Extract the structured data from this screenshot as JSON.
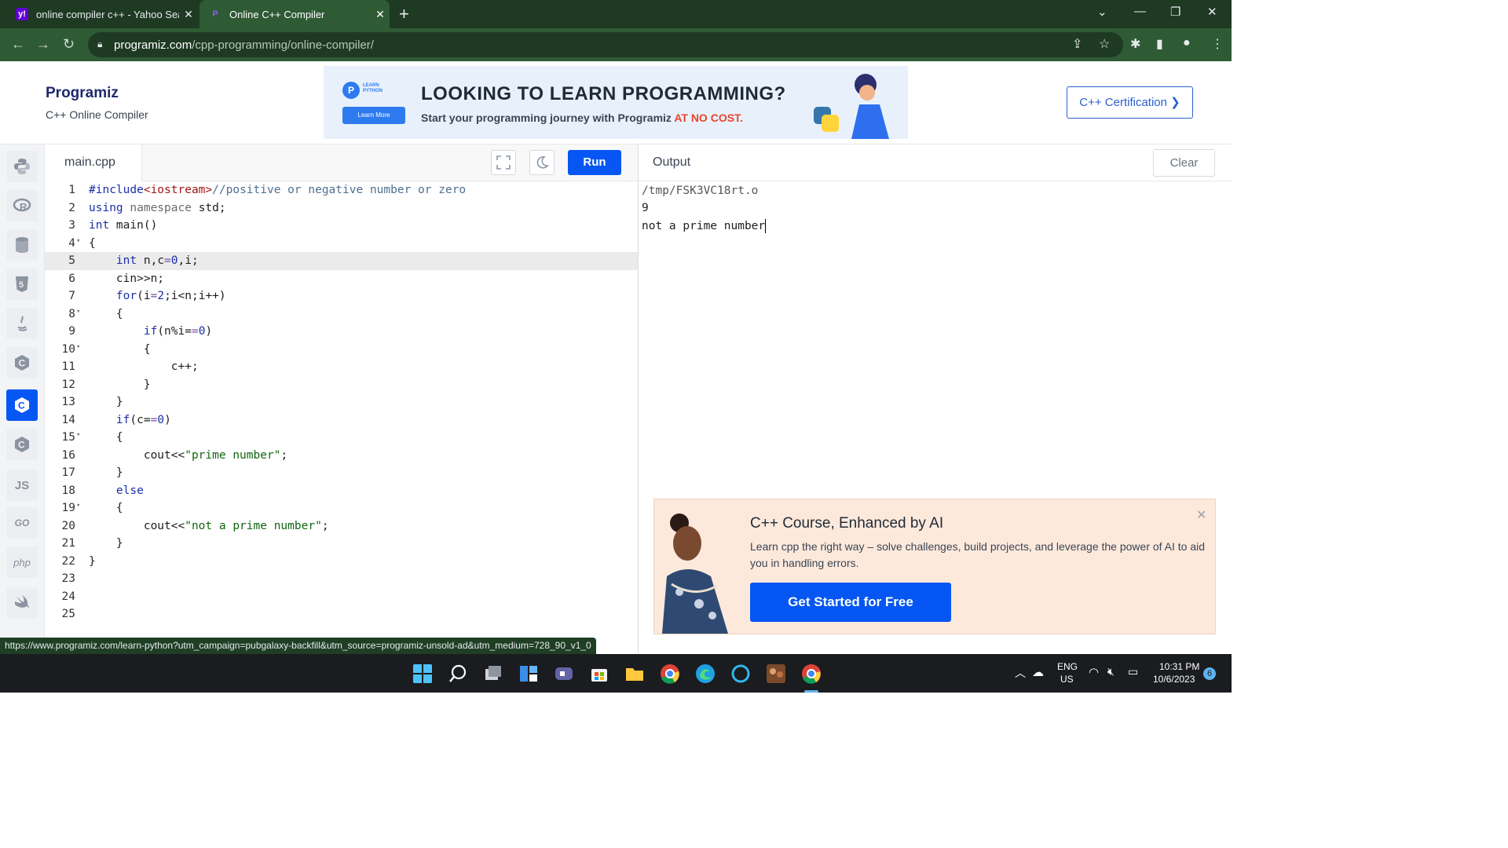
{
  "browser": {
    "tabs": [
      {
        "favicon": "y!",
        "title": "online compiler c++ - Yahoo Sea",
        "close": "✕"
      },
      {
        "favicon": "P",
        "title": "Online C++ Compiler",
        "close": "✕"
      }
    ],
    "new_tab": "+",
    "address": {
      "host": "programiz.com",
      "path": "/cpp-programming/online-compiler/"
    }
  },
  "header": {
    "logo": "Programiz",
    "subtitle": "C++ Online Compiler",
    "banner": {
      "badge": "LEARN PYTHON",
      "badge_button": "Learn More",
      "headline": "LOOKING TO LEARN PROGRAMMING?",
      "subline": "Start your programming journey with Programiz",
      "subline_highlight": "AT NO COST."
    },
    "certification_button": "C++ Certification ❯"
  },
  "sidebar": {
    "languages": [
      {
        "name": "python",
        "label": ""
      },
      {
        "name": "r",
        "label": ""
      },
      {
        "name": "sql",
        "label": ""
      },
      {
        "name": "html",
        "label": ""
      },
      {
        "name": "java",
        "label": ""
      },
      {
        "name": "c",
        "label": ""
      },
      {
        "name": "cpp",
        "label": "",
        "active": true
      },
      {
        "name": "csharp",
        "label": ""
      },
      {
        "name": "js",
        "label": "JS"
      },
      {
        "name": "go",
        "label": "GO"
      },
      {
        "name": "php",
        "label": "php"
      },
      {
        "name": "swift",
        "label": ""
      }
    ]
  },
  "editor": {
    "file_tab": "main.cpp",
    "run_label": "Run",
    "lines": [
      {
        "n": "1",
        "code": "#include<iostream>//positive or negative number or zero",
        "fold": ""
      },
      {
        "n": "2",
        "code": "using namespace std;",
        "fold": ""
      },
      {
        "n": "3",
        "code": "int main()",
        "fold": ""
      },
      {
        "n": "4",
        "code": "{",
        "fold": "▾"
      },
      {
        "n": "5",
        "code": "    int n,c=0,i;",
        "fold": "",
        "highlight": true
      },
      {
        "n": "6",
        "code": "    cin>>n;",
        "fold": ""
      },
      {
        "n": "7",
        "code": "    for(i=2;i<n;i++)",
        "fold": ""
      },
      {
        "n": "8",
        "code": "    {",
        "fold": "▾"
      },
      {
        "n": "9",
        "code": "        if(n%i==0)",
        "fold": ""
      },
      {
        "n": "10",
        "code": "        {",
        "fold": "▾"
      },
      {
        "n": "11",
        "code": "            c++;",
        "fold": ""
      },
      {
        "n": "12",
        "code": "        }",
        "fold": ""
      },
      {
        "n": "13",
        "code": "    }",
        "fold": ""
      },
      {
        "n": "14",
        "code": "    if(c==0)",
        "fold": ""
      },
      {
        "n": "15",
        "code": "    {",
        "fold": "▾"
      },
      {
        "n": "16",
        "code": "        cout<<\"prime number\";",
        "fold": ""
      },
      {
        "n": "17",
        "code": "    }",
        "fold": ""
      },
      {
        "n": "18",
        "code": "    else",
        "fold": ""
      },
      {
        "n": "19",
        "code": "    {",
        "fold": "▾"
      },
      {
        "n": "20",
        "code": "        cout<<\"not a prime number\";",
        "fold": ""
      },
      {
        "n": "21",
        "code": "    }",
        "fold": ""
      },
      {
        "n": "22",
        "code": "}",
        "fold": ""
      },
      {
        "n": "23",
        "code": "",
        "fold": ""
      },
      {
        "n": "24",
        "code": "",
        "fold": ""
      },
      {
        "n": "25",
        "code": "",
        "fold": ""
      }
    ]
  },
  "output": {
    "label": "Output",
    "clear_label": "Clear",
    "lines": [
      "/tmp/FSK3VC18rt.o",
      "9",
      "not a prime number"
    ]
  },
  "ad": {
    "title": "C++ Course, Enhanced by AI",
    "description": "Learn cpp the right way – solve challenges, build projects, and leverage the power of AI to aid you in handling errors.",
    "button": "Get Started for Free",
    "close": "✕"
  },
  "status_url": "https://www.programiz.com/learn-python?utm_campaign=pubgalaxy-backfill&utm_source=programiz-unsold-ad&utm_medium=728_90_v1_0",
  "taskbar": {
    "lang_top": "ENG",
    "lang_bottom": "US",
    "time": "10:31 PM",
    "date": "10/6/2023",
    "notifications": "6"
  },
  "colors": {
    "accent": "#0556f3",
    "chrome_dark": "#1e3a23",
    "chrome": "#2e5a34"
  }
}
